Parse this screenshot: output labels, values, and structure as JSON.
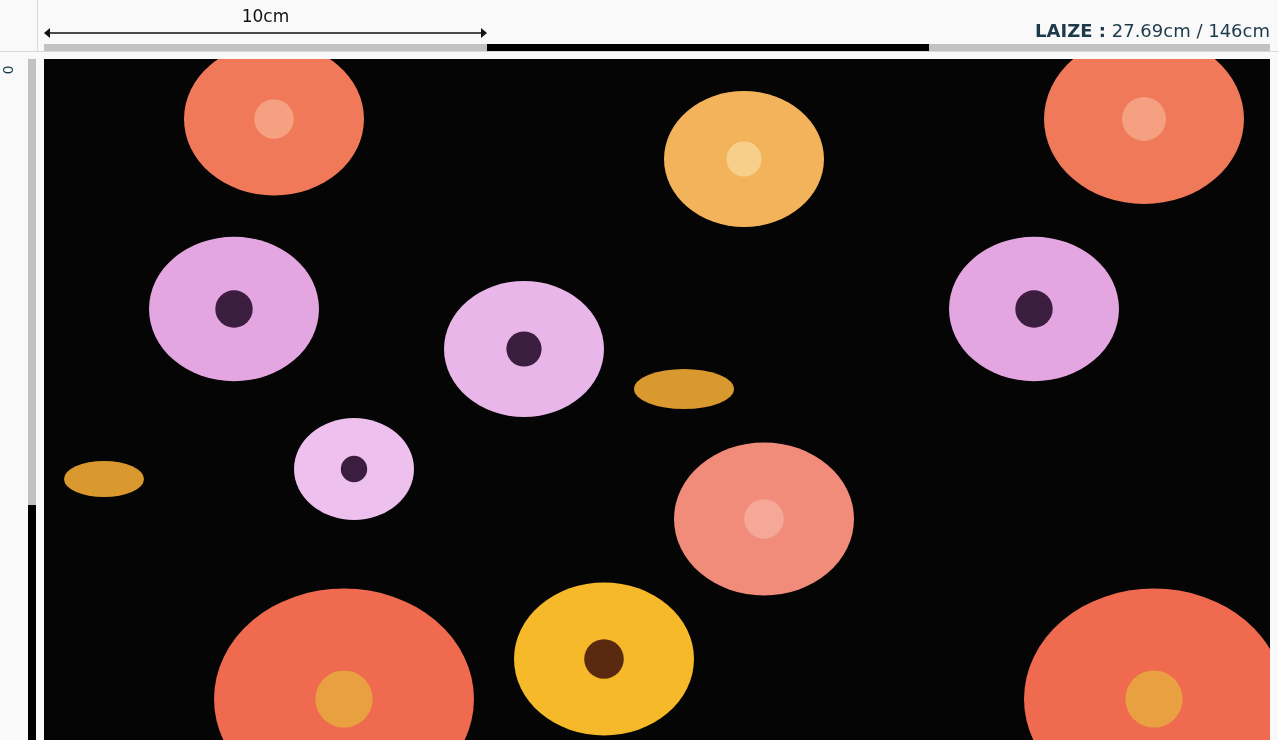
{
  "ruler": {
    "measure_label": "10cm",
    "vertical_label": "0"
  },
  "width_info": {
    "label": "LAIZE :",
    "value": "27.69cm / 146cm"
  }
}
